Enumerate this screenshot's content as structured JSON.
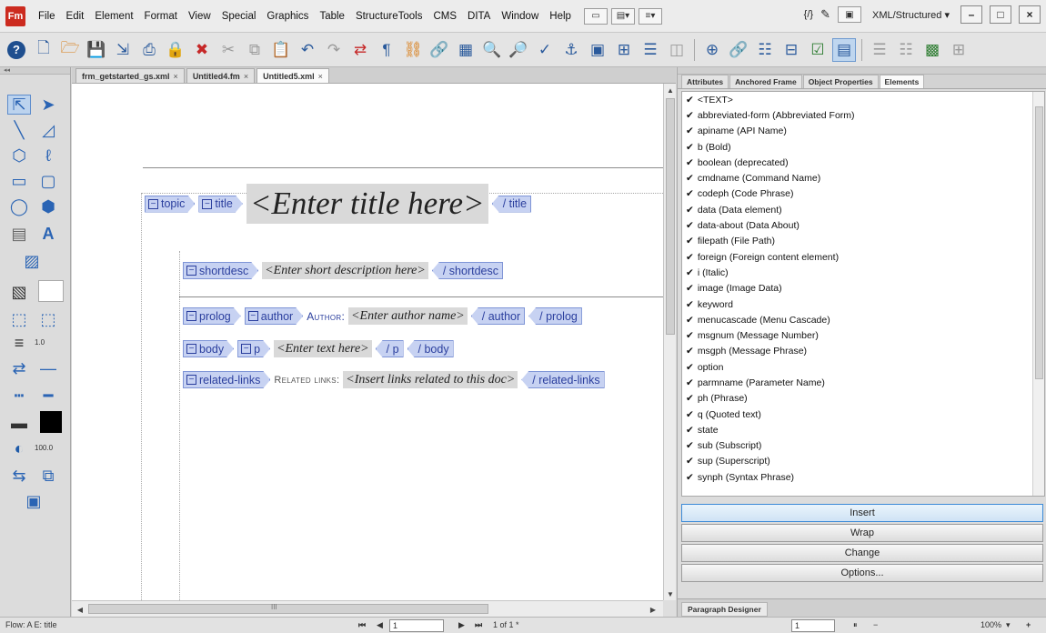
{
  "app": {
    "logo_text": "Fm",
    "menu": [
      "File",
      "Edit",
      "Element",
      "Format",
      "View",
      "Special",
      "Graphics",
      "Table",
      "StructureTools",
      "CMS",
      "DITA",
      "Window",
      "Help"
    ],
    "workspace": "XML/Structured",
    "workspace_arrow": "▾",
    "brace_icon": "{/}",
    "pencil_icon": "✎"
  },
  "doc_tabs": [
    {
      "label": "frm_getstarted_gs.xml",
      "close": "×"
    },
    {
      "label": "Untitled4.fm",
      "close": "×"
    },
    {
      "label": "Untitled5.xml",
      "close": "×"
    }
  ],
  "document": {
    "topic_tag": "topic",
    "title_tag": "title",
    "title_placeholder": "<Enter title here>",
    "title_end": "/ title",
    "shortdesc_tag": "shortdesc",
    "shortdesc_placeholder": "<Enter short description here>",
    "shortdesc_end": "/ shortdesc",
    "prolog_tag": "prolog",
    "author_tag": "author",
    "author_label": "Author:",
    "author_placeholder": "<Enter author name>",
    "author_end": "/ author",
    "prolog_end": "/ prolog",
    "body_tag": "body",
    "p_tag": "p",
    "text_placeholder": "<Enter text here>",
    "p_end": "/ p",
    "body_end": "/ body",
    "related_tag": "related-links",
    "related_label": "Related links:",
    "related_placeholder": "<Insert links related to this doc>",
    "related_end": "/ related-links",
    "collapse_glyph": "−"
  },
  "tools": {
    "line_weight": "1.0",
    "tint": "100.0"
  },
  "panel": {
    "tabs": [
      "Attributes",
      "Anchored Frame",
      "Object Properties",
      "Elements"
    ],
    "elements": [
      "<TEXT>",
      "abbreviated-form  (Abbreviated Form)",
      "apiname  (API Name)",
      "b  (Bold)",
      "boolean  (deprecated)",
      "cmdname  (Command Name)",
      "codeph  (Code Phrase)",
      "data  (Data element)",
      "data-about  (Data About)",
      "filepath  (File Path)",
      "foreign  (Foreign content element)",
      "i  (Italic)",
      "image  (Image Data)",
      "keyword",
      "menucascade  (Menu Cascade)",
      "msgnum  (Message Number)",
      "msgph  (Message Phrase)",
      "option",
      "parmname  (Parameter Name)",
      "ph  (Phrase)",
      "q  (Quoted text)",
      "state",
      "sub  (Subscript)",
      "sup  (Superscript)",
      "synph  (Syntax Phrase)"
    ],
    "check": "✔",
    "buttons": {
      "insert": "Insert",
      "wrap": "Wrap",
      "change": "Change",
      "options": "Options..."
    },
    "para_designer": "Paragraph Designer"
  },
  "status": {
    "flow": "Flow: A  E: title",
    "page_field": "1",
    "page_count": "1 of 1 *",
    "zoom": "100%",
    "zoom_arrow": "▾",
    "field2": "1",
    "minus": "−",
    "plus": "+"
  },
  "scrollbar": {
    "grip": "III"
  }
}
